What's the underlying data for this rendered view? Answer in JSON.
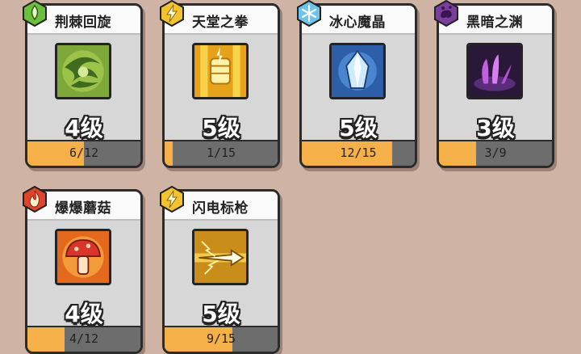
{
  "cards": [
    {
      "name": "荆棘回旋",
      "level": "4级",
      "progress": "6/12",
      "progress_fraction": 0.5,
      "element_icon": "leaf-drop-icon",
      "element_color": "#6abf3c",
      "icon": "thorn-whirl-icon"
    },
    {
      "name": "天堂之拳",
      "level": "5级",
      "progress": "1/15",
      "progress_fraction": 0.067,
      "element_icon": "lightning-icon",
      "element_color": "#f2c230",
      "icon": "heaven-fist-icon"
    },
    {
      "name": "冰心魔晶",
      "level": "5级",
      "progress": "12/15",
      "progress_fraction": 0.8,
      "element_icon": "snowflake-icon",
      "element_color": "#6ec3ea",
      "icon": "ice-crystal-icon"
    },
    {
      "name": "黑暗之渊",
      "level": "3级",
      "progress": "3/9",
      "progress_fraction": 0.333,
      "element_icon": "dark-splash-icon",
      "element_color": "#7a3e9c",
      "icon": "dark-abyss-icon"
    },
    {
      "name": "爆爆蘑菇",
      "level": "4级",
      "progress": "4/12",
      "progress_fraction": 0.333,
      "element_icon": "fire-icon",
      "element_color": "#e0442a",
      "icon": "explosive-mushroom-icon"
    },
    {
      "name": "闪电标枪",
      "level": "5级",
      "progress": "9/15",
      "progress_fraction": 0.6,
      "element_icon": "lightning-icon",
      "element_color": "#f2c230",
      "icon": "lightning-javelin-icon"
    }
  ],
  "colors": {
    "background": "#cfb4a6",
    "progress_fill": "#f5b04a",
    "progress_track": "#6d6d6d"
  }
}
